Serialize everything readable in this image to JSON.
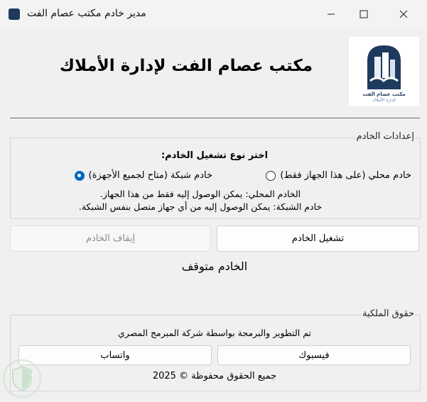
{
  "window": {
    "title": "مدير خادم مكتب عصام الفت"
  },
  "header": {
    "heading": "مكتب عصام الفت لإدارة الأملاك",
    "logo_line1": "مكتب عصام الفت",
    "logo_line2": "لإدارة الأملاك"
  },
  "server_settings": {
    "group_label": "إعدادات الخادم",
    "choose_label": "اختر نوع تشغيل الخادم:",
    "option_local": "خادم محلي (على هذا الجهاز فقط)",
    "option_network": "خادم شبكة (متاح لجميع الأجهزة)",
    "selected": "network",
    "desc_local": "الخادم المحلي: يمكن الوصول إليه فقط من هذا الجهاز.",
    "desc_network": "خادم الشبكة: يمكن الوصول إليه من أي جهاز متصل بنفس الشبكة."
  },
  "actions": {
    "start": "تشغيل الخادم",
    "stop": "إيقاف الخادم"
  },
  "status": {
    "text": "الخادم متوقف"
  },
  "copyright": {
    "group_label": "حقوق الملكية",
    "developer": "تم التطوير والبرمجة بواسطة شركة المبرمج المصري",
    "facebook": "فيسبوك",
    "whatsapp": "واتساب",
    "rights": "جميع الحقوق محفوظة © 2025"
  },
  "colors": {
    "accent": "#0067c0",
    "logo_navy": "#1f3a5f"
  }
}
